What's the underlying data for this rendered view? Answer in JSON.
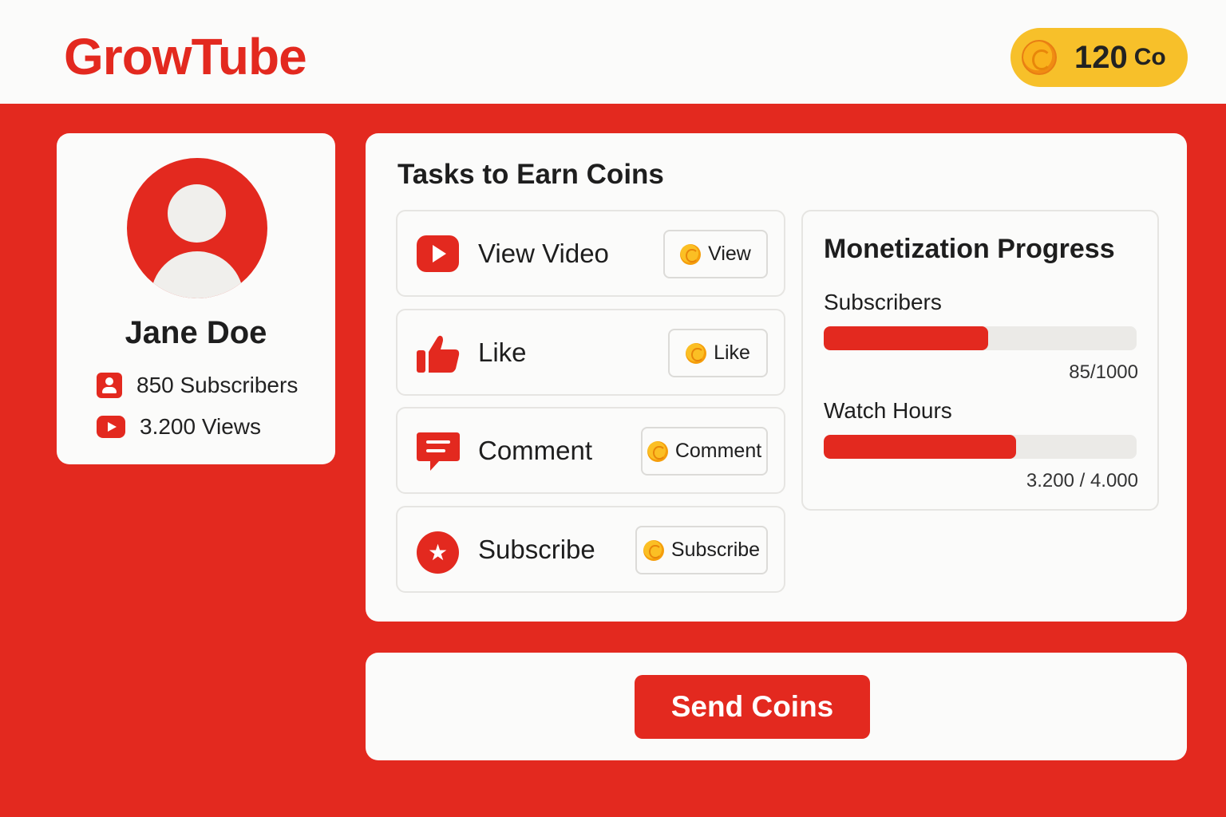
{
  "app": {
    "name": "GrowTube"
  },
  "wallet": {
    "balance": "120",
    "unit": "Co",
    "icon": "coin-icon",
    "color": "#f7c02a"
  },
  "profile": {
    "name": "Jane Doe",
    "subscribers": "850 Subscribers",
    "views": "3.200 Views",
    "avatar_icon": "user-avatar-icon"
  },
  "tasks": {
    "title": "Tasks to Earn Coins",
    "items": [
      {
        "label": "View Video",
        "button": "View",
        "icon": "play-button-icon"
      },
      {
        "label": "Like",
        "button": "Like",
        "icon": "thumbs-up-icon"
      },
      {
        "label": "Comment",
        "button": "Comment",
        "icon": "comment-icon"
      },
      {
        "label": "Subscribe",
        "button": "Subscribe",
        "icon": "star-icon"
      }
    ]
  },
  "monetization": {
    "title": "Monetization Progress",
    "metrics": [
      {
        "label": "Subscribers",
        "value": "85/1000",
        "progress": 0.525
      },
      {
        "label": "Watch Hours",
        "value": "3.200 / 4.000",
        "progress": 0.615
      }
    ]
  },
  "actions": {
    "send_label": "Send Coins"
  },
  "colors": {
    "brand": "#e3291f",
    "coin": "#f7c02a",
    "card": "#fbfbfa"
  }
}
